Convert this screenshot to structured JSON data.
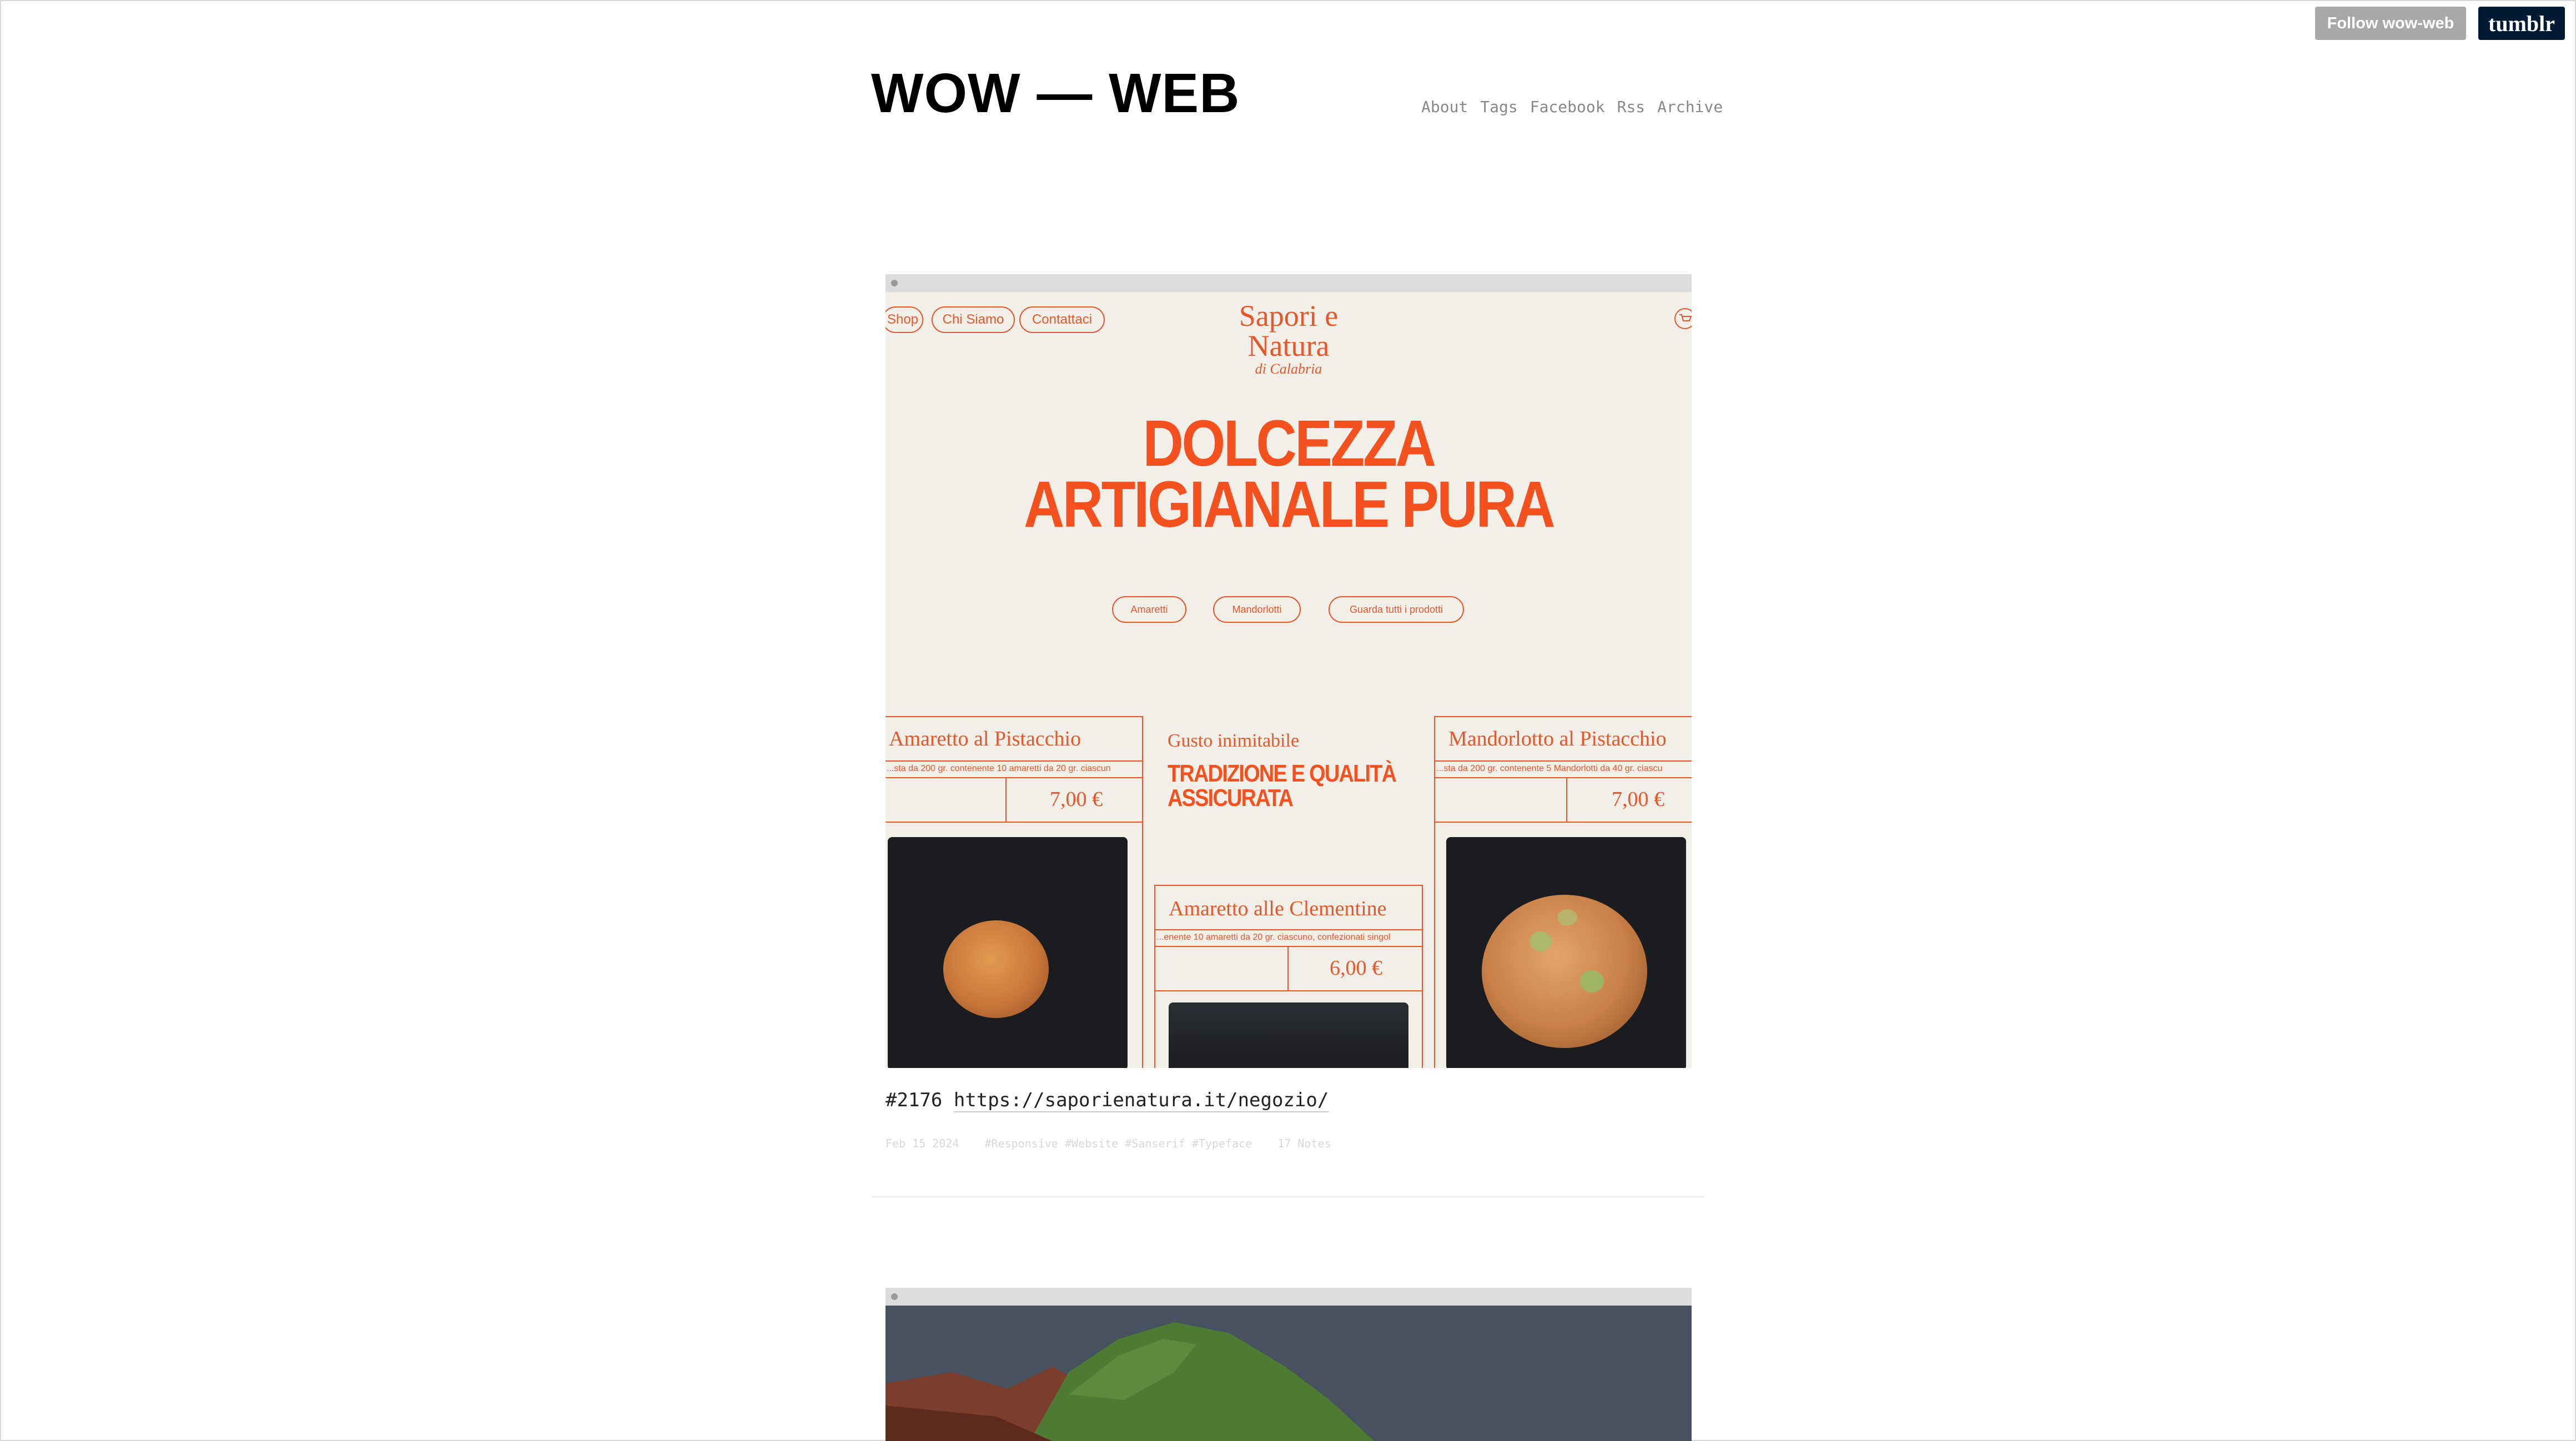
{
  "header": {
    "follow_label": "Follow wow-web",
    "tumblr_label": "tumblr",
    "site_title": "WOW — WEB",
    "nav": [
      "About",
      "Tags",
      "Facebook",
      "Rss",
      "Archive"
    ]
  },
  "post1": {
    "screenshot": {
      "nav_pills": [
        "Shop",
        "Chi Siamo",
        "Contattaci"
      ],
      "brand_name": "Sapori e Natura",
      "brand_sub": "di Calabria",
      "hero_line1": "DOLCEZZA",
      "hero_line2": "ARTIGIANALE PURA",
      "category_pills": [
        "Amaretti",
        "Mandorlotti",
        "Guarda tutti i prodotti"
      ],
      "product_left": {
        "title": "Amaretto al Pistacchio",
        "desc": "...sta da 200 gr. contenente 10 amaretti da 20 gr. ciascun",
        "price": "7,00 €"
      },
      "center_block": {
        "label": "Gusto inimitabile",
        "headline1": "TRADIZIONE E QUALITÀ",
        "headline2": "ASSICURATA"
      },
      "product_center": {
        "title": "Amaretto alle Clementine",
        "desc": "...enente 10 amaretti da 20 gr. ciascuno, confezionati singol",
        "price": "6,00 €"
      },
      "product_right": {
        "title": "Mandorlotto al Pistacchio",
        "desc": "...sta da 200 gr. contenente 5 Mandorlotti da 40 gr. ciascu",
        "price": "7,00 €"
      }
    },
    "caption_number": "#2176",
    "caption_url": "https://saporienatura.it/negozio/",
    "date": "Feb  15 2024",
    "tags": "#Responsive #Website #Sanserif #Typeface",
    "notes": "17 Notes"
  },
  "colors": {
    "accent_orange": "#f4511e",
    "page_bg": "#ffffff",
    "tumblr_navy": "#001935"
  }
}
